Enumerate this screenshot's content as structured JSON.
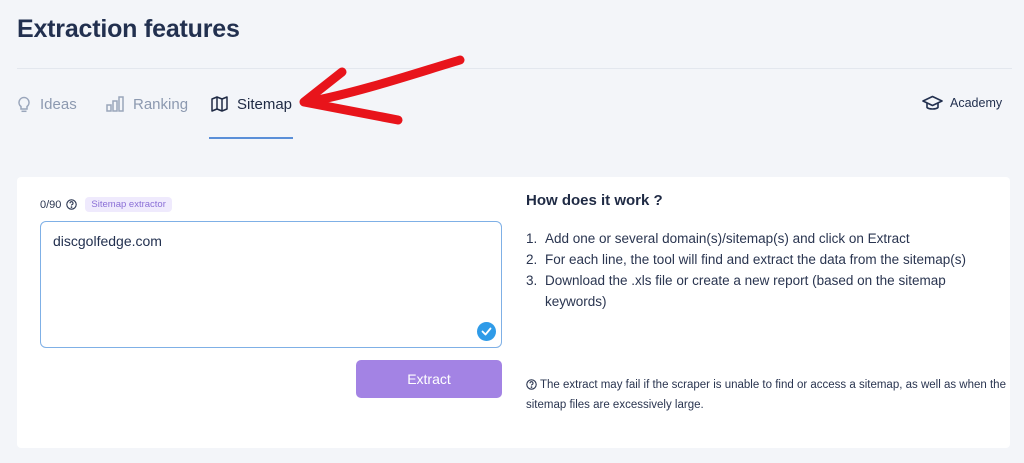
{
  "header": {
    "title": "Extraction features"
  },
  "tabs": [
    {
      "label": "Ideas",
      "icon": "lightbulb-icon",
      "active": false
    },
    {
      "label": "Ranking",
      "icon": "bar-chart-icon",
      "active": false
    },
    {
      "label": "Sitemap",
      "icon": "map-icon",
      "active": true
    }
  ],
  "academy": {
    "label": "Academy",
    "icon": "graduation-cap-icon"
  },
  "form": {
    "counter": "0/90",
    "badge": "Sitemap extractor",
    "input_value": "discgolfedge.com",
    "extract_label": "Extract"
  },
  "info": {
    "title": "How does it work ?",
    "steps": [
      {
        "num": "1.",
        "text": "Add one or several domain(s)/sitemap(s) and click on Extract"
      },
      {
        "num": "2.",
        "text": "For each line, the tool will find and extract the data from the sitemap(s)"
      },
      {
        "num": "3.",
        "text": "Download the .xls file or create a new report (based on the sitemap keywords)"
      }
    ],
    "note": "The extract may fail if the scraper is unable to find or access a sitemap, as well as when the sitemap files are excessively large."
  },
  "colors": {
    "accent": "#a383e4",
    "active_tab_underline": "#5a8fd8",
    "annotation": "#e8141b",
    "check": "#2f9be8"
  }
}
